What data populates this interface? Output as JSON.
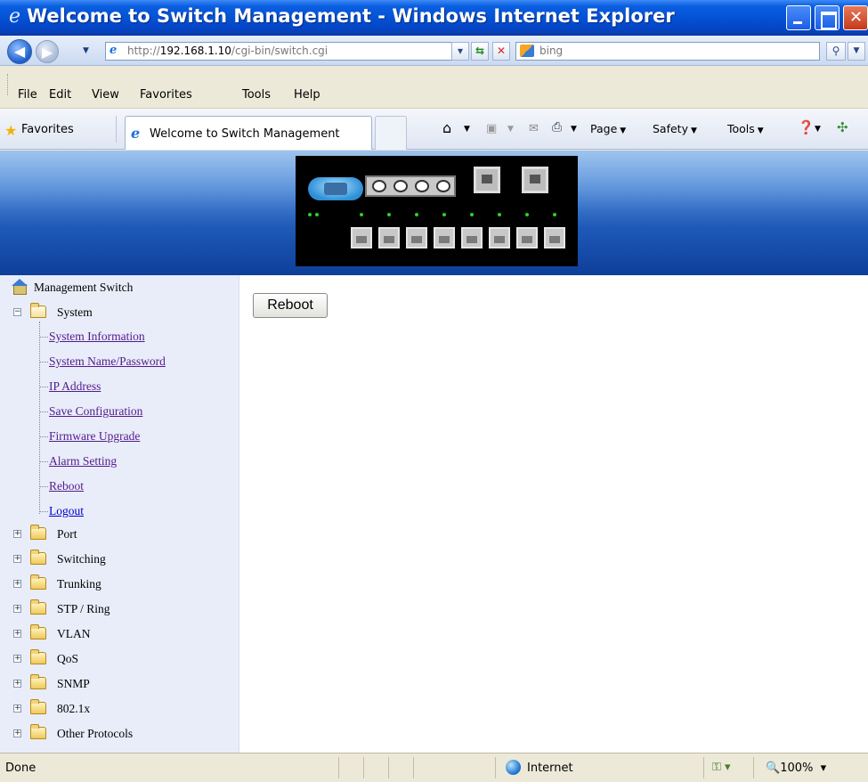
{
  "window": {
    "title": "Welcome to Switch Management - Windows Internet Explorer"
  },
  "address_bar": {
    "url_prefix": "http://",
    "url_host": "192.168.1.10",
    "url_path": "/cgi-bin/switch.cgi",
    "search_placeholder": "bing"
  },
  "menu": {
    "items": [
      "File",
      "Edit",
      "View",
      "Favorites",
      "Tools",
      "Help"
    ]
  },
  "favorites_bar": {
    "favorites_label": "Favorites",
    "active_tab": "Welcome to Switch Management",
    "commands": {
      "page": "Page",
      "safety": "Safety",
      "tools": "Tools"
    }
  },
  "sidebar": {
    "root": "Management Switch",
    "system": {
      "label": "System",
      "children": [
        "System Information",
        "System Name/Password",
        "IP Address",
        "Save Configuration",
        "Firmware Upgrade",
        "Alarm Setting",
        "Reboot",
        "Logout"
      ]
    },
    "folders": [
      "Port",
      "Switching",
      "Trunking",
      "STP / Ring",
      "VLAN",
      "QoS",
      "SNMP",
      "802.1x",
      "Other Protocols"
    ]
  },
  "main": {
    "reboot_button": "Reboot"
  },
  "status_bar": {
    "status": "Done",
    "zone": "Internet",
    "zoom": "100%"
  },
  "icons": {
    "ie_logo": "ie-logo-icon",
    "home": "home-icon",
    "feeds": "feeds-icon",
    "mail": "mail-icon",
    "print": "print-icon",
    "help": "help-icon",
    "research": "research-icon",
    "globe": "globe-icon",
    "star": "favorites-star-icon"
  },
  "colors": {
    "title_bar": "#0453d6",
    "banner_top": "#7eb0ea",
    "banner_bottom": "#0d3f9a",
    "sidebar_bg": "#e8edf9",
    "visited_link": "#551a8b",
    "link": "#0000cc"
  }
}
